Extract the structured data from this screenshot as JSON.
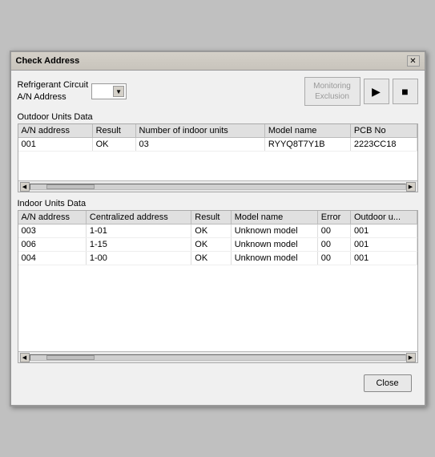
{
  "window": {
    "title": "Check Address",
    "close_label": "✕"
  },
  "controls": {
    "refrigerant_label": "Refrigerant Circuit",
    "an_label": "A/N Address",
    "combo_value": "",
    "combo_arrow": "▼",
    "monitoring_btn_line1": "Monitoring",
    "monitoring_btn_line2": "Exclusion",
    "play_icon": "▶",
    "stop_icon": "■"
  },
  "outdoor": {
    "section_label": "Outdoor Units Data",
    "columns": [
      "A/N address",
      "Result",
      "Number of indoor units",
      "Model name",
      "PCB No"
    ],
    "rows": [
      [
        "001",
        "OK",
        "03",
        "RYYQ8T7Y1B",
        "2223CC18"
      ]
    ]
  },
  "indoor": {
    "section_label": "Indoor Units Data",
    "columns": [
      "A/N address",
      "Centralized address",
      "Result",
      "Model name",
      "Error",
      "Outdoor u..."
    ],
    "rows": [
      [
        "003",
        "1-01",
        "OK",
        "Unknown model",
        "00",
        "001"
      ],
      [
        "006",
        "1-15",
        "OK",
        "Unknown model",
        "00",
        "001"
      ],
      [
        "004",
        "1-00",
        "OK",
        "Unknown model",
        "00",
        "001"
      ]
    ]
  },
  "footer": {
    "close_label": "Close"
  }
}
